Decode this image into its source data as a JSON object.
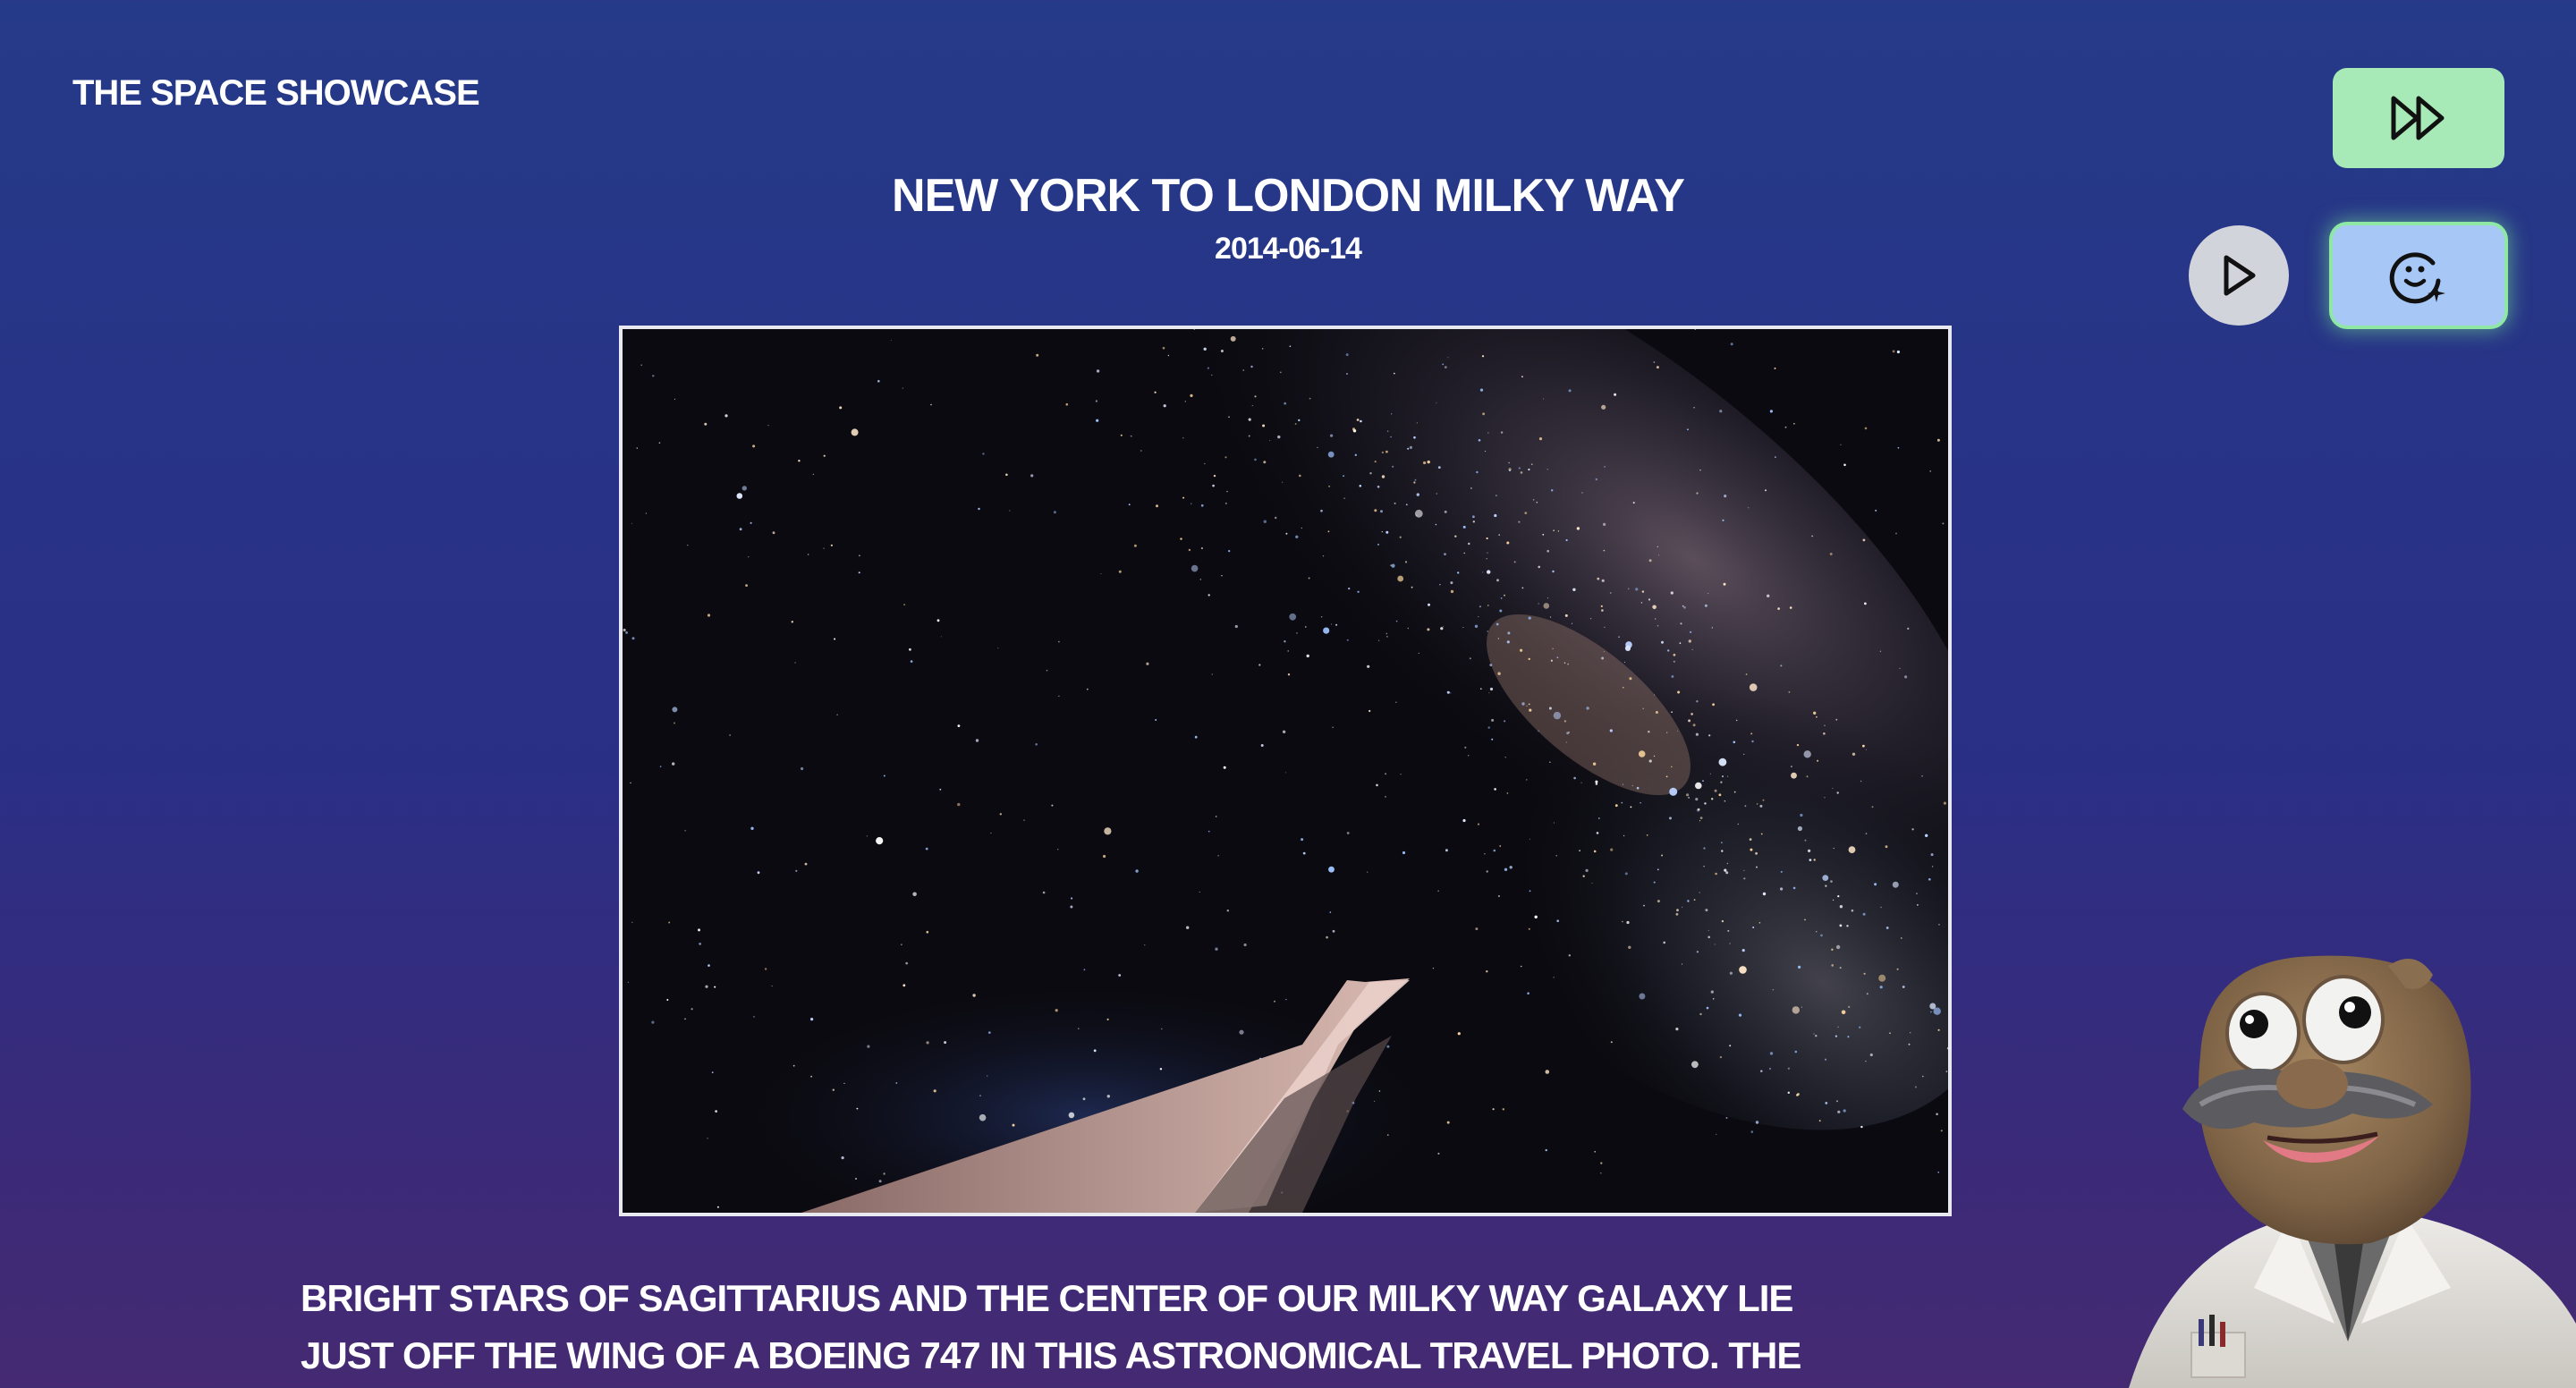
{
  "site": {
    "title": "THE SPACE SHOWCASE"
  },
  "apod": {
    "title": "NEW YORK TO LONDON MILKY WAY",
    "date": "2014-06-14",
    "image_alt": "Milky Way seen from the wing of a Boeing 747",
    "description": "Bright stars of Sagittarius and the center of our Milky Way Galaxy lie just off the wing of a Boeing 747 in this astronomical travel photo. The stratospheric scene"
  },
  "controls": {
    "skip_icon": "fast-forward-icon",
    "play_icon": "play-icon",
    "assistant_icon": "face-sparkle-icon"
  },
  "colors": {
    "skip_button": "#a7eab8",
    "play_button": "#d2d4dc",
    "assistant_button": "#a7c8f6",
    "assistant_glow": "#8fe7a6"
  },
  "mascot": {
    "name": "burlap-scientist-mascot"
  }
}
